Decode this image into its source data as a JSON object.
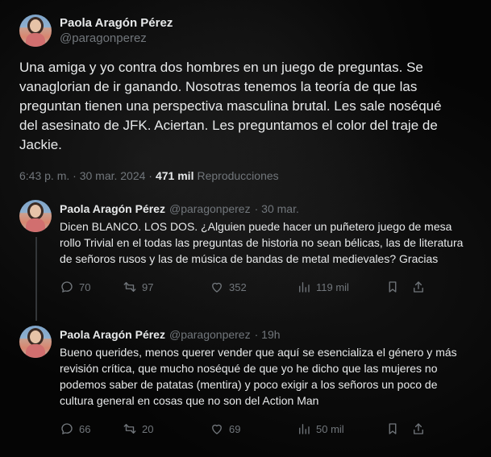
{
  "main_tweet": {
    "display_name": "Paola Aragón Pérez",
    "handle": "@paragonperez",
    "text": "Una amiga y yo contra dos hombres en un juego de preguntas. Se vanaglorian de ir ganando. Nosotras tenemos la teoría de que las preguntan tienen una perspectiva masculina brutal. Les sale noséqué del asesinato de JFK. Aciertan. Les preguntamos el color del traje de Jackie.",
    "timestamp": "6:43 p. m. · 30 mar. 2024 ·",
    "views_count": "471 mil",
    "views_label": "Reproducciones"
  },
  "replies": [
    {
      "display_name": "Paola Aragón Pérez",
      "handle": "@paragonperez",
      "time": "· 30 mar.",
      "text": "Dicen BLANCO. LOS DOS. ¿Alguien puede hacer un puñetero juego de mesa rollo Trivial en el todas las preguntas de historia no sean bélicas, las de literatura de señoros rusos y las de música de bandas de metal medievales? Gracias",
      "replies": "70",
      "retweets": "97",
      "likes": "352",
      "views": "119 mil"
    },
    {
      "display_name": "Paola Aragón Pérez",
      "handle": "@paragonperez",
      "time": "· 19h",
      "text": "Bueno querides, menos querer vender que aquí se esencializa el género y más revisión crítica, que mucho noséqué de que yo he dicho que las mujeres no podemos saber de patatas (mentira) y poco exigir a los señoros un poco de cultura general en cosas que no son del Action Man",
      "replies": "66",
      "retweets": "20",
      "likes": "69",
      "views": "50 mil"
    }
  ],
  "icons": {
    "reply": "reply-icon",
    "retweet": "retweet-icon",
    "like": "heart-icon",
    "views": "views-icon",
    "bookmark": "bookmark-icon",
    "share": "share-icon"
  },
  "colors": {
    "background": "#000000",
    "text": "#e7e9ea",
    "muted": "#71767b",
    "thread_line": "#333639"
  }
}
